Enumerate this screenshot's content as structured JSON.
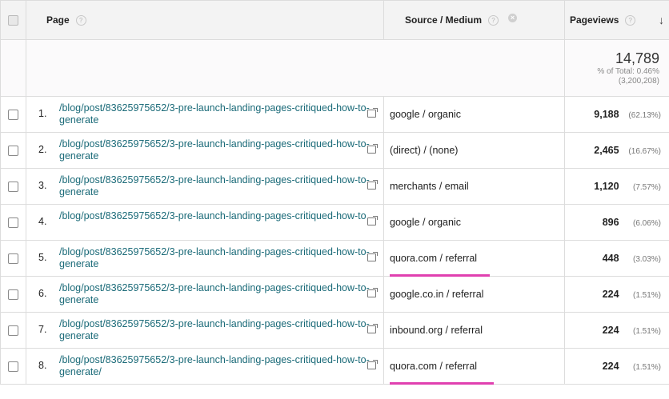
{
  "header": {
    "page_label": "Page",
    "source_medium_label": "Source / Medium",
    "pageviews_label": "Pageviews",
    "help_glyph": "?",
    "remove_glyph": "×",
    "sort_glyph": "↓"
  },
  "totals": {
    "pageviews": "14,789",
    "percent_of_total": "% of Total: 0.46%",
    "grand_total": "(3,200,208)"
  },
  "highlight_color": "#e040b0",
  "rows": [
    {
      "rank": "1.",
      "page": "/blog/post/83625975652/3-pre-launch-landing-pages-critiqued-how-to-generate",
      "source": "google / organic",
      "pageviews": "9,188",
      "percent": "(62.13%)",
      "highlight": false
    },
    {
      "rank": "2.",
      "page": "/blog/post/83625975652/3-pre-launch-landing-pages-critiqued-how-to-generate",
      "source": "(direct) / (none)",
      "pageviews": "2,465",
      "percent": "(16.67%)",
      "highlight": false
    },
    {
      "rank": "3.",
      "page": "/blog/post/83625975652/3-pre-launch-landing-pages-critiqued-how-to-generate",
      "source": "merchants / email",
      "pageviews": "1,120",
      "percent": "(7.57%)",
      "highlight": false
    },
    {
      "rank": "4.",
      "page": "/blog/post/83625975652/3-pre-launch-landing-pages-critiqued-how-to",
      "source": "google / organic",
      "pageviews": "896",
      "percent": "(6.06%)",
      "highlight": false
    },
    {
      "rank": "5.",
      "page": "/blog/post/83625975652/3-pre-launch-landing-pages-critiqued-how-to-generate",
      "source": "quora.com / referral",
      "pageviews": "448",
      "percent": "(3.03%)",
      "highlight": true
    },
    {
      "rank": "6.",
      "page": "/blog/post/83625975652/3-pre-launch-landing-pages-critiqued-how-to-generate",
      "source": "google.co.in / referral",
      "pageviews": "224",
      "percent": "(1.51%)",
      "highlight": false
    },
    {
      "rank": "7.",
      "page": "/blog/post/83625975652/3-pre-launch-landing-pages-critiqued-how-to-generate",
      "source": "inbound.org / referral",
      "pageviews": "224",
      "percent": "(1.51%)",
      "highlight": false
    },
    {
      "rank": "8.",
      "page": "/blog/post/83625975652/3-pre-launch-landing-pages-critiqued-how-to-generate/",
      "source": "quora.com / referral",
      "pageviews": "224",
      "percent": "(1.51%)",
      "highlight": true
    }
  ]
}
